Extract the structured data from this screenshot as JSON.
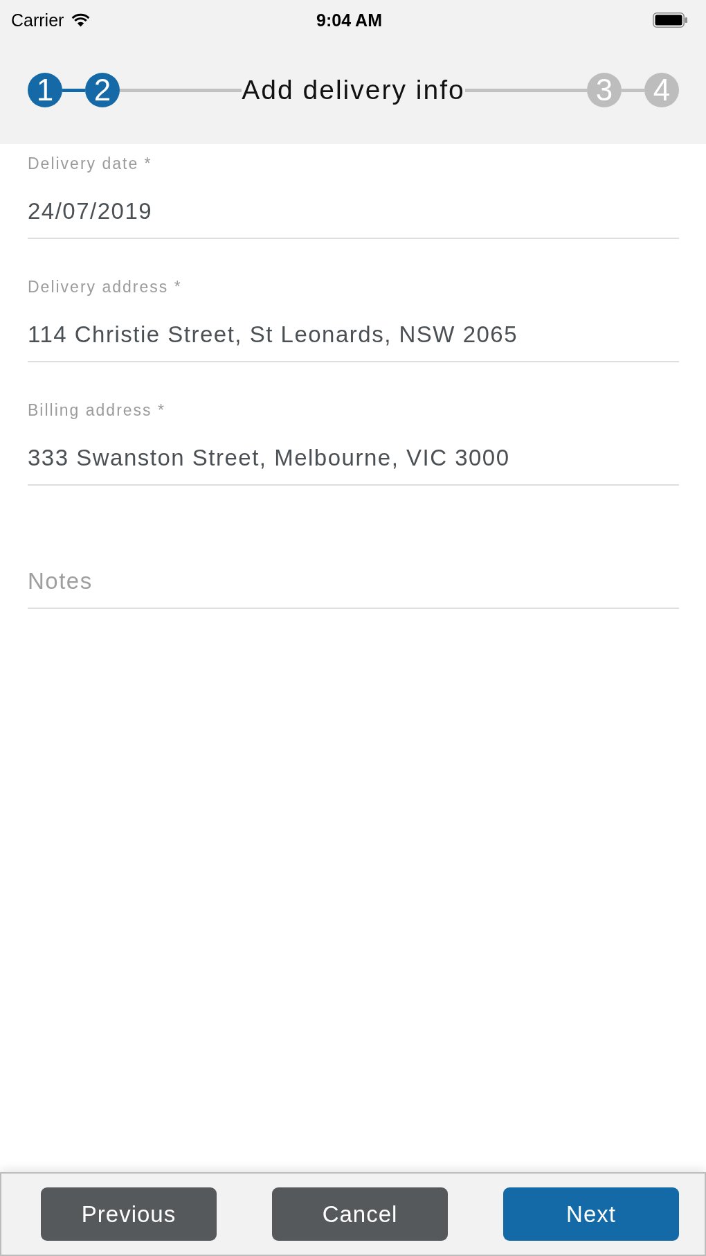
{
  "status_bar": {
    "carrier": "Carrier",
    "time": "9:04 AM"
  },
  "stepper": {
    "title": "Add delivery info",
    "steps": [
      {
        "label": "1",
        "active": true
      },
      {
        "label": "2",
        "active": true
      },
      {
        "label": "3",
        "active": false
      },
      {
        "label": "4",
        "active": false
      }
    ]
  },
  "fields": [
    {
      "label": "Delivery date *",
      "value": "24/07/2019"
    },
    {
      "label": "Delivery address *",
      "value": "114 Christie Street, St Leonards, NSW 2065"
    },
    {
      "label": "Billing address *",
      "value": "333 Swanston Street, Melbourne, VIC 3000"
    },
    {
      "placeholder": "Notes"
    }
  ],
  "buttons": [
    {
      "label": "Previous",
      "kind": "secondary"
    },
    {
      "label": "Cancel",
      "kind": "secondary"
    },
    {
      "label": "Next",
      "kind": "primary"
    }
  ]
}
